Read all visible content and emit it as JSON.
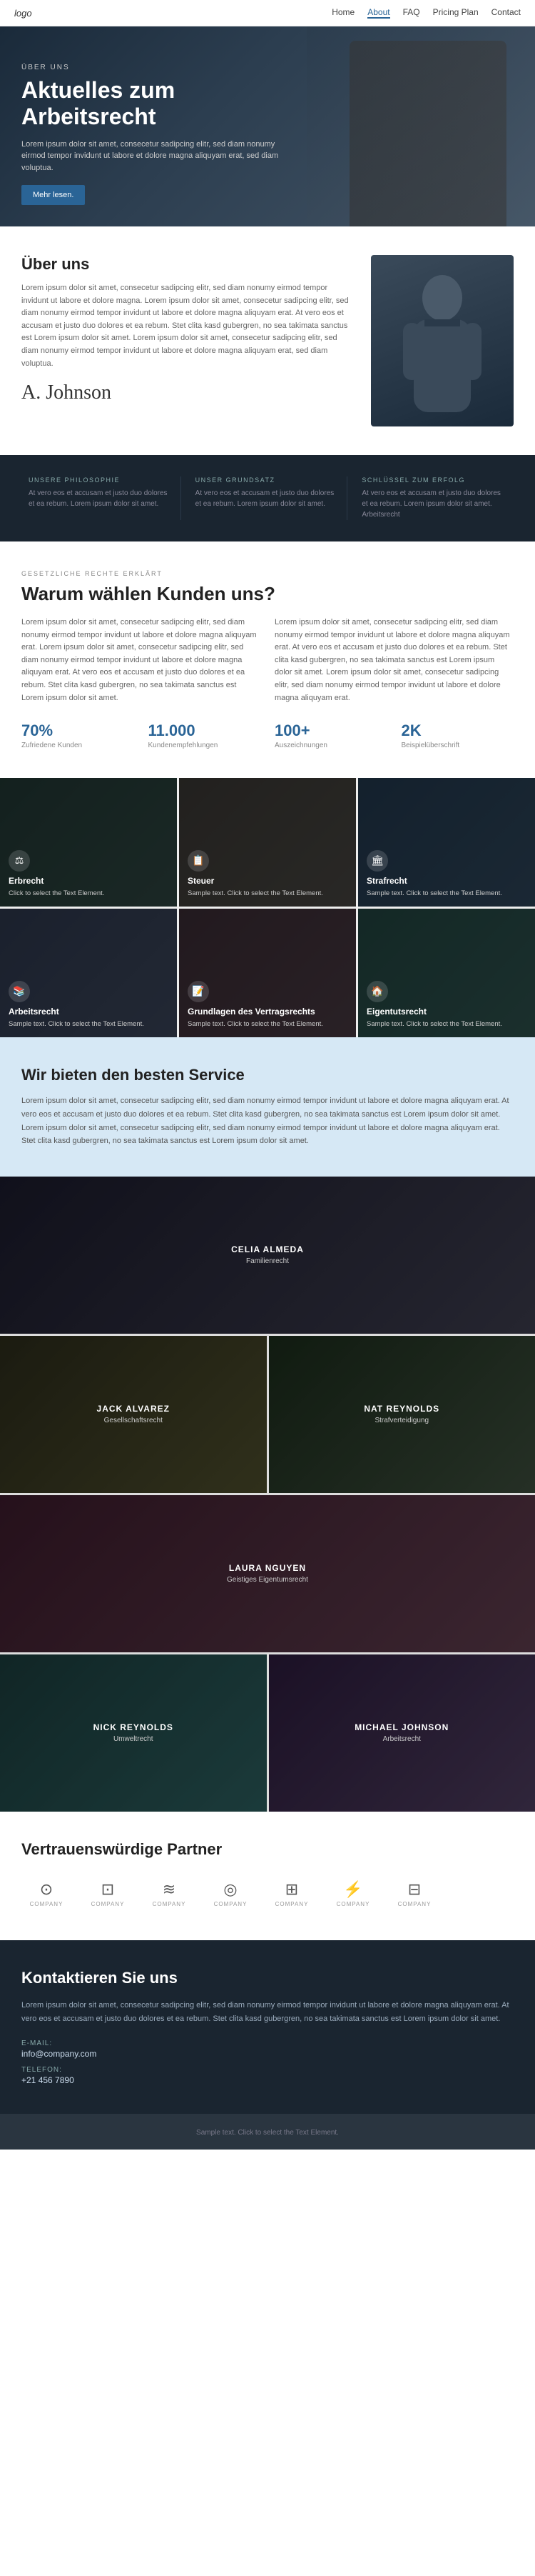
{
  "nav": {
    "logo": "logo",
    "links": [
      "Home",
      "About",
      "FAQ",
      "Pricing Plan",
      "Contact"
    ],
    "active_link": "About"
  },
  "hero": {
    "eyebrow": "ÜBER UNS",
    "title": "Aktuelles zum Arbeitsrecht",
    "description": "Lorem ipsum dolor sit amet, consecetur sadipcing elitr, sed diam nonumy eirmod tempor invidunt ut labore et dolore magna aliquyam erat, sed diam voluptua.",
    "button_label": "Mehr lesen."
  },
  "uber": {
    "title": "Über uns",
    "body": "Lorem ipsum dolor sit amet, consecetur sadipcing elitr, sed diam nonumy eirmod tempor invidunt ut labore et dolore magna. Lorem ipsum dolor sit amet, consecetur sadipcing elitr, sed diam nonumy eirmod tempor invidunt ut labore et dolore magna aliquyam erat. At vero eos et accusam et justo duo dolores et ea rebum. Stet clita kasd gubergren, no sea takimata sanctus est Lorem ipsum dolor sit amet. Lorem ipsum dolor sit amet, consecetur sadipcing elitr, sed diam nonumy eirmod tempor invidunt ut labore et dolore magna aliquyam erat, sed diam voluptua.",
    "signature": "A. Johnson"
  },
  "dark_banner": {
    "items": [
      {
        "eyebrow": "UNSERE PHILOSOPHIE",
        "title": "",
        "body": "At vero eos et accusam et justo duo dolores et ea rebum. Lorem ipsum dolor sit amet."
      },
      {
        "eyebrow": "UNSER GRUNDSATZ",
        "title": "",
        "body": "At vero eos et accusam et justo duo dolores et ea rebum. Lorem ipsum dolor sit amet."
      },
      {
        "eyebrow": "SCHLÜSSEL ZUM ERFOLG",
        "title": "",
        "body": "At vero eos et accusam et justo duo dolores et ea rebum. Lorem ipsum dolor sit amet. Arbeitsrecht"
      }
    ]
  },
  "warum": {
    "eyebrow": "GESETZLICHE RECHTE ERKLÄRT",
    "title": "Warum wählen Kunden uns?",
    "col1": "Lorem ipsum dolor sit amet, consecetur sadipcing elitr, sed diam nonumy eirmod tempor invidunt ut labore et dolore magna aliquyam erat. Lorem ipsum dolor sit amet, consecetur sadipcing elitr, sed diam nonumy eirmod tempor invidunt ut labore et dolore magna aliquyam erat. At vero eos et accusam et justo duo dolores et ea rebum. Stet clita kasd gubergren, no sea takimata sanctus est Lorem ipsum dolor sit amet.",
    "col2": "Lorem ipsum dolor sit amet, consecetur sadipcing elitr, sed diam nonumy eirmod tempor invidunt ut labore et dolore magna aliquyam erat. At vero eos et accusam et justo duo dolores et ea rebum. Stet clita kasd gubergren, no sea takimata sanctus est Lorem ipsum dolor sit amet. Lorem ipsum dolor sit amet, consecetur sadipcing elitr, sed diam nonumy eirmod tempor invidunt ut labore et dolore magna aliquyam erat.",
    "stats": [
      {
        "number": "70%",
        "label": "Zufriedene Kunden"
      },
      {
        "number": "11.000",
        "label": "Kundenempfehlungen"
      },
      {
        "number": "100+",
        "label": "Auszeichnungen"
      },
      {
        "number": "2K",
        "label": "Beispielüberschrift"
      }
    ]
  },
  "services": {
    "cards": [
      {
        "icon": "⚖",
        "title": "Erbrecht",
        "body": "Click to select the Text Element."
      },
      {
        "icon": "📋",
        "title": "Steuer",
        "body": "Sample text. Click to select the Text Element."
      },
      {
        "icon": "🏛",
        "title": "Strafrecht",
        "body": "Sample text. Click to select the Text Element."
      },
      {
        "icon": "📚",
        "title": "Arbeitsrecht",
        "body": "Sample text. Click to select the Text Element."
      },
      {
        "icon": "📝",
        "title": "Grundlagen des Vertragsrechts",
        "body": "Sample text. Click to select the Text Element."
      },
      {
        "icon": "🏠",
        "title": "Eigentutsrecht",
        "body": "Sample text. Click to select the Text Element."
      }
    ]
  },
  "best_service": {
    "title": "Wir bieten den besten Service",
    "body": "Lorem ipsum dolor sit amet, consecetur sadipcing elitr, sed diam nonumy eirmod tempor invidunt ut labore et dolore magna aliquyam erat. At vero eos et accusam et justo duo dolores et ea rebum. Stet clita kasd gubergren, no sea takimata sanctus est Lorem ipsum dolor sit amet. Lorem ipsum dolor sit amet, consecetur sadipcing elitr, sed diam nonumy eirmod tempor invidunt ut labore et dolore magna aliquyam erat. Stet clita kasd gubergren, no sea takimata sanctus est Lorem ipsum dolor sit amet."
  },
  "team": {
    "members": [
      {
        "name": "CELIA ALMEDA",
        "role": "Familienrecht",
        "layout": "center"
      },
      {
        "name": "JACK ALVAREZ",
        "role": "Gesellschaftsrecht",
        "layout": "left"
      },
      {
        "name": "NAT REYNOLDS",
        "role": "Strafverteidigung",
        "layout": "right"
      },
      {
        "name": "LAURA NGUYEN",
        "role": "Geistiges Eigentumsrecht",
        "layout": "center"
      },
      {
        "name": "NICK REYNOLDS",
        "role": "Umweltrecht",
        "layout": "left"
      },
      {
        "name": "MICHAEL JOHNSON",
        "role": "Arbeitsrecht",
        "layout": "right"
      }
    ]
  },
  "partners": {
    "title": "Vertrauenswürdige Partner",
    "logos": [
      {
        "icon": "⊙",
        "label": "COMPANY"
      },
      {
        "icon": "⊡",
        "label": "COMPANY"
      },
      {
        "icon": "≋",
        "label": "COMPANY"
      },
      {
        "icon": "◎",
        "label": "COMPANY"
      },
      {
        "icon": "⊞",
        "label": "COMPANY"
      },
      {
        "icon": "⚡",
        "label": "COMPANY"
      },
      {
        "icon": "⊟",
        "label": "COMPANY"
      }
    ]
  },
  "contact": {
    "title": "Kontaktieren Sie uns",
    "body": "Lorem ipsum dolor sit amet, consecetur sadipcing elitr, sed diam nonumy eirmod tempor invidunt ut labore et dolore magna aliquyam erat. At vero eos et accusam et justo duo dolores et ea rebum. Stet clita kasd gubergren, no sea takimata sanctus est Lorem ipsum dolor sit amet.",
    "email_label": "E-Mail:",
    "email_value": "info@company.com",
    "phone_label": "Telefon:",
    "phone_value": "+21 456 7890"
  },
  "footer": {
    "sample_text": "Sample text. Click to select the Text Element."
  }
}
